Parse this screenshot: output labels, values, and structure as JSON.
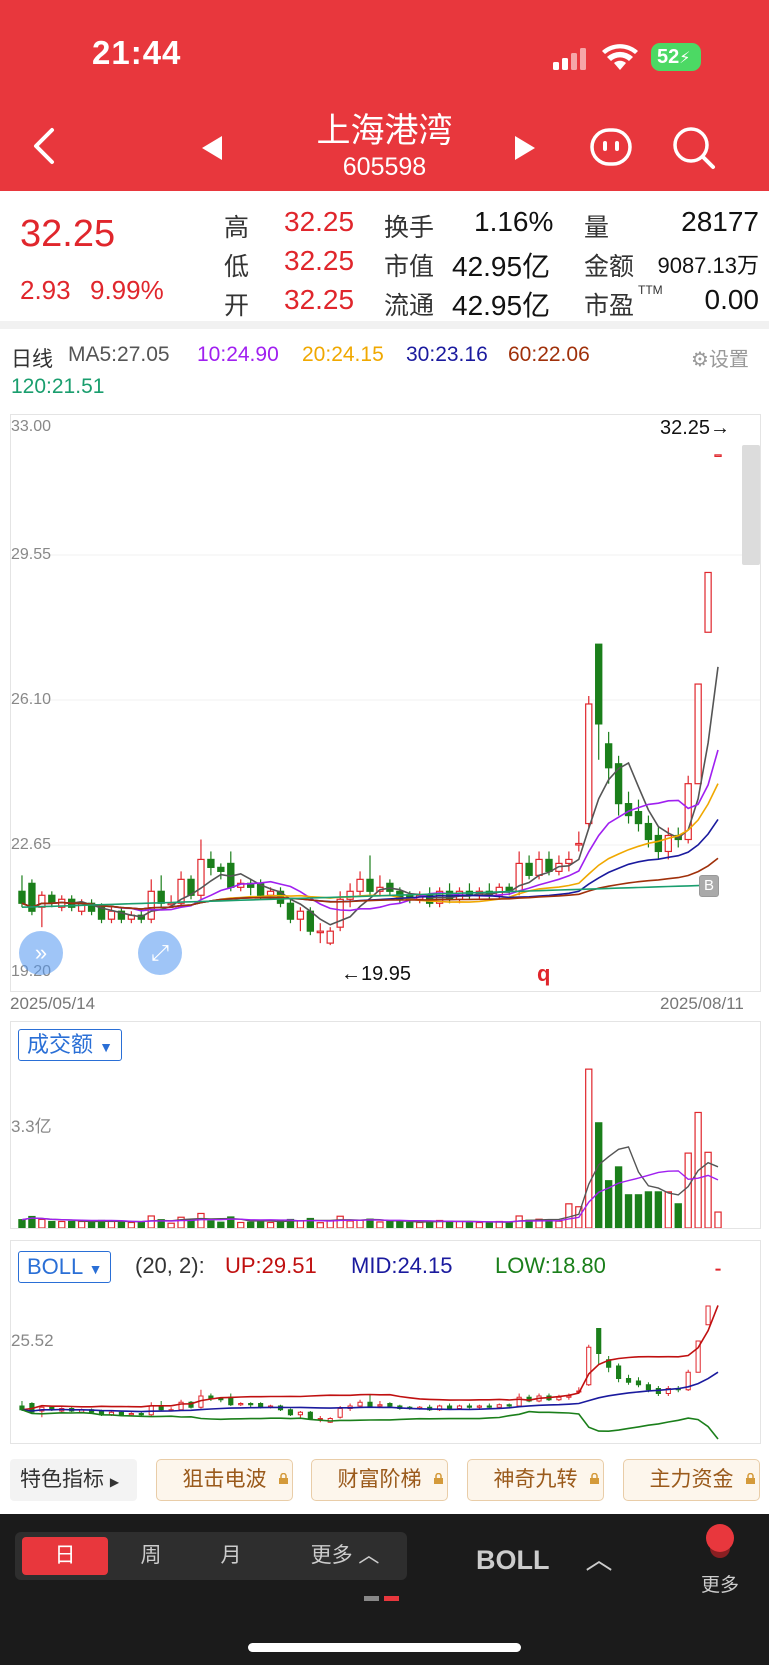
{
  "status_bar": {
    "time": "21:44",
    "battery": "52"
  },
  "header": {
    "stock_name": "上海港湾",
    "stock_code": "605598"
  },
  "quote": {
    "price": "32.25",
    "change": "2.93",
    "change_pct": "9.99%",
    "high_label": "高",
    "high": "32.25",
    "low_label": "低",
    "low": "32.25",
    "open_label": "开",
    "open": "32.25",
    "turnover_label": "换手",
    "turnover": "1.16%",
    "mktcap_label": "市值",
    "mktcap": "42.95亿",
    "float_label": "流通",
    "float_cap": "42.95亿",
    "volume_label": "量",
    "volume": "28177",
    "amount_label": "金额",
    "amount": "9087.13万",
    "pe_label": "市盈",
    "pe_sup": "TTM",
    "pe": "0.00"
  },
  "ma_legend": {
    "period": "日线",
    "ma5": "MA5:27.05",
    "ma10": "10:24.90",
    "ma20": "20:24.15",
    "ma30": "30:23.16",
    "ma60": "60:22.06",
    "ma120": "120:21.51",
    "settings": "设置"
  },
  "colors": {
    "header": "#e8373d",
    "up": "#e0262c",
    "down": "#1b7f1b",
    "ma5": "#555555",
    "ma10": "#a020f0",
    "ma20": "#f0a800",
    "ma30": "#1a1a9e",
    "ma60": "#a0300a",
    "ma120": "#1a9e6e"
  },
  "main_chart": {
    "y_ticks": [
      "33.00",
      "29.55",
      "26.10",
      "22.65",
      "19.20"
    ],
    "max_label": "32.25→",
    "min_label": "←19.95",
    "marker_q": "q",
    "marker_b": "B",
    "date_start": "2025/05/14",
    "date_end": "2025/08/11"
  },
  "volume_panel": {
    "dropdown": "成交额",
    "y_tick": "3.3亿"
  },
  "boll_panel": {
    "dropdown": "BOLL",
    "params": "(20, 2):",
    "up": "UP:29.51",
    "mid": "MID:24.15",
    "low": "LOW:18.80",
    "y_tick": "25.52"
  },
  "indicator_bar": {
    "label": "特色指标",
    "chips": [
      "狙击电波",
      "财富阶梯",
      "神奇九转",
      "主力资金"
    ]
  },
  "bottom_bar": {
    "tabs": [
      "日",
      "周",
      "月",
      "更多"
    ],
    "indicator": "BOLL",
    "more": "更多"
  },
  "chart_data": {
    "type": "candlestick",
    "x_range": [
      "2025/05/14",
      "2025/08/11"
    ],
    "ylim": [
      19.2,
      33.0
    ],
    "y_ticks": [
      33.0,
      29.55,
      26.1,
      22.65,
      19.2
    ],
    "candles": [
      {
        "o": 21.3,
        "c": 21.0,
        "h": 21.7,
        "l": 20.9
      },
      {
        "o": 21.5,
        "c": 20.8,
        "h": 21.6,
        "l": 20.7
      },
      {
        "o": 20.9,
        "c": 21.2,
        "h": 21.3,
        "l": 20.4
      },
      {
        "o": 21.2,
        "c": 21.0,
        "h": 21.3,
        "l": 20.9
      },
      {
        "o": 20.9,
        "c": 21.1,
        "h": 21.2,
        "l": 20.8
      },
      {
        "o": 21.1,
        "c": 20.9,
        "h": 21.2,
        "l": 20.8
      },
      {
        "o": 20.8,
        "c": 21.0,
        "h": 21.1,
        "l": 20.7
      },
      {
        "o": 21.0,
        "c": 20.8,
        "h": 21.1,
        "l": 20.7
      },
      {
        "o": 20.9,
        "c": 20.6,
        "h": 21.0,
        "l": 20.5
      },
      {
        "o": 20.6,
        "c": 20.8,
        "h": 20.9,
        "l": 20.5
      },
      {
        "o": 20.8,
        "c": 20.6,
        "h": 20.9,
        "l": 20.5
      },
      {
        "o": 20.6,
        "c": 20.7,
        "h": 20.8,
        "l": 20.5
      },
      {
        "o": 20.7,
        "c": 20.6,
        "h": 20.8,
        "l": 20.5
      },
      {
        "o": 20.6,
        "c": 21.3,
        "h": 21.6,
        "l": 20.5
      },
      {
        "o": 21.3,
        "c": 21.0,
        "h": 21.7,
        "l": 20.9
      },
      {
        "o": 21.0,
        "c": 21.0,
        "h": 21.2,
        "l": 20.9
      },
      {
        "o": 21.0,
        "c": 21.6,
        "h": 21.8,
        "l": 20.9
      },
      {
        "o": 21.6,
        "c": 21.2,
        "h": 21.7,
        "l": 21.1
      },
      {
        "o": 21.2,
        "c": 22.1,
        "h": 22.6,
        "l": 21.1
      },
      {
        "o": 22.1,
        "c": 21.9,
        "h": 22.3,
        "l": 21.7
      },
      {
        "o": 21.9,
        "c": 21.8,
        "h": 22.0,
        "l": 21.6
      },
      {
        "o": 22.0,
        "c": 21.4,
        "h": 22.3,
        "l": 21.3
      },
      {
        "o": 21.4,
        "c": 21.5,
        "h": 21.6,
        "l": 21.3
      },
      {
        "o": 21.5,
        "c": 21.4,
        "h": 21.6,
        "l": 21.2
      },
      {
        "o": 21.5,
        "c": 21.2,
        "h": 21.6,
        "l": 21.1
      },
      {
        "o": 21.2,
        "c": 21.3,
        "h": 21.4,
        "l": 21.1
      },
      {
        "o": 21.3,
        "c": 21.0,
        "h": 21.4,
        "l": 20.9
      },
      {
        "o": 21.0,
        "c": 20.6,
        "h": 21.1,
        "l": 20.5
      },
      {
        "o": 20.6,
        "c": 20.8,
        "h": 20.9,
        "l": 20.3
      },
      {
        "o": 20.8,
        "c": 20.3,
        "h": 20.9,
        "l": 20.2
      },
      {
        "o": 20.3,
        "c": 20.3,
        "h": 20.5,
        "l": 20.0
      },
      {
        "o": 20.0,
        "c": 20.3,
        "h": 20.4,
        "l": 19.95
      },
      {
        "o": 20.4,
        "c": 21.1,
        "h": 21.3,
        "l": 20.3
      },
      {
        "o": 21.1,
        "c": 21.3,
        "h": 21.5,
        "l": 20.9
      },
      {
        "o": 21.3,
        "c": 21.6,
        "h": 21.8,
        "l": 21.2
      },
      {
        "o": 21.6,
        "c": 21.3,
        "h": 22.2,
        "l": 21.2
      },
      {
        "o": 21.3,
        "c": 21.4,
        "h": 21.7,
        "l": 21.2
      },
      {
        "o": 21.5,
        "c": 21.3,
        "h": 21.6,
        "l": 21.2
      },
      {
        "o": 21.3,
        "c": 21.1,
        "h": 21.4,
        "l": 21.0
      },
      {
        "o": 21.2,
        "c": 21.1,
        "h": 21.3,
        "l": 21.0
      },
      {
        "o": 21.1,
        "c": 21.2,
        "h": 21.3,
        "l": 21.0
      },
      {
        "o": 21.2,
        "c": 21.0,
        "h": 21.4,
        "l": 20.9
      },
      {
        "o": 21.0,
        "c": 21.3,
        "h": 21.4,
        "l": 20.9
      },
      {
        "o": 21.3,
        "c": 21.1,
        "h": 21.5,
        "l": 21.0
      },
      {
        "o": 21.1,
        "c": 21.3,
        "h": 21.4,
        "l": 21.0
      },
      {
        "o": 21.3,
        "c": 21.2,
        "h": 21.5,
        "l": 21.1
      },
      {
        "o": 21.2,
        "c": 21.3,
        "h": 21.4,
        "l": 21.1
      },
      {
        "o": 21.3,
        "c": 21.2,
        "h": 21.5,
        "l": 21.1
      },
      {
        "o": 21.2,
        "c": 21.4,
        "h": 21.5,
        "l": 21.1
      },
      {
        "o": 21.4,
        "c": 21.3,
        "h": 21.5,
        "l": 21.2
      },
      {
        "o": 21.3,
        "c": 22.0,
        "h": 22.3,
        "l": 21.2
      },
      {
        "o": 22.0,
        "c": 21.7,
        "h": 22.2,
        "l": 21.6
      },
      {
        "o": 21.7,
        "c": 22.1,
        "h": 22.3,
        "l": 21.6
      },
      {
        "o": 22.1,
        "c": 21.8,
        "h": 22.3,
        "l": 21.7
      },
      {
        "o": 21.8,
        "c": 22.0,
        "h": 22.2,
        "l": 21.7
      },
      {
        "o": 22.0,
        "c": 22.1,
        "h": 22.3,
        "l": 21.8
      },
      {
        "o": 22.5,
        "c": 22.5,
        "h": 22.8,
        "l": 22.3
      },
      {
        "o": 23.0,
        "c": 26.0,
        "h": 26.2,
        "l": 22.9
      },
      {
        "o": 27.5,
        "c": 25.5,
        "h": 27.5,
        "l": 24.6
      },
      {
        "o": 25.0,
        "c": 24.4,
        "h": 25.3,
        "l": 24.0
      },
      {
        "o": 24.5,
        "c": 23.5,
        "h": 24.7,
        "l": 23.2
      },
      {
        "o": 23.5,
        "c": 23.2,
        "h": 23.8,
        "l": 23.0
      },
      {
        "o": 23.3,
        "c": 23.0,
        "h": 23.6,
        "l": 22.8
      },
      {
        "o": 23.0,
        "c": 22.6,
        "h": 23.2,
        "l": 22.4
      },
      {
        "o": 22.7,
        "c": 22.3,
        "h": 22.9,
        "l": 22.1
      },
      {
        "o": 22.3,
        "c": 22.7,
        "h": 22.9,
        "l": 22.1
      },
      {
        "o": 22.7,
        "c": 22.6,
        "h": 22.9,
        "l": 22.4
      },
      {
        "o": 22.6,
        "c": 24.0,
        "h": 24.2,
        "l": 22.5
      },
      {
        "o": 24.0,
        "c": 26.5,
        "h": 26.5,
        "l": 24.0
      },
      {
        "o": 27.8,
        "c": 29.3,
        "h": 29.3,
        "l": 27.8
      },
      {
        "o": 32.25,
        "c": 32.25,
        "h": 32.25,
        "l": 32.25
      }
    ],
    "volume_ticks": [
      "3.3亿"
    ],
    "boll": {
      "params": "(20, 2)",
      "up": 29.51,
      "mid": 24.15,
      "low": 18.8,
      "y_tick": 25.52
    }
  }
}
